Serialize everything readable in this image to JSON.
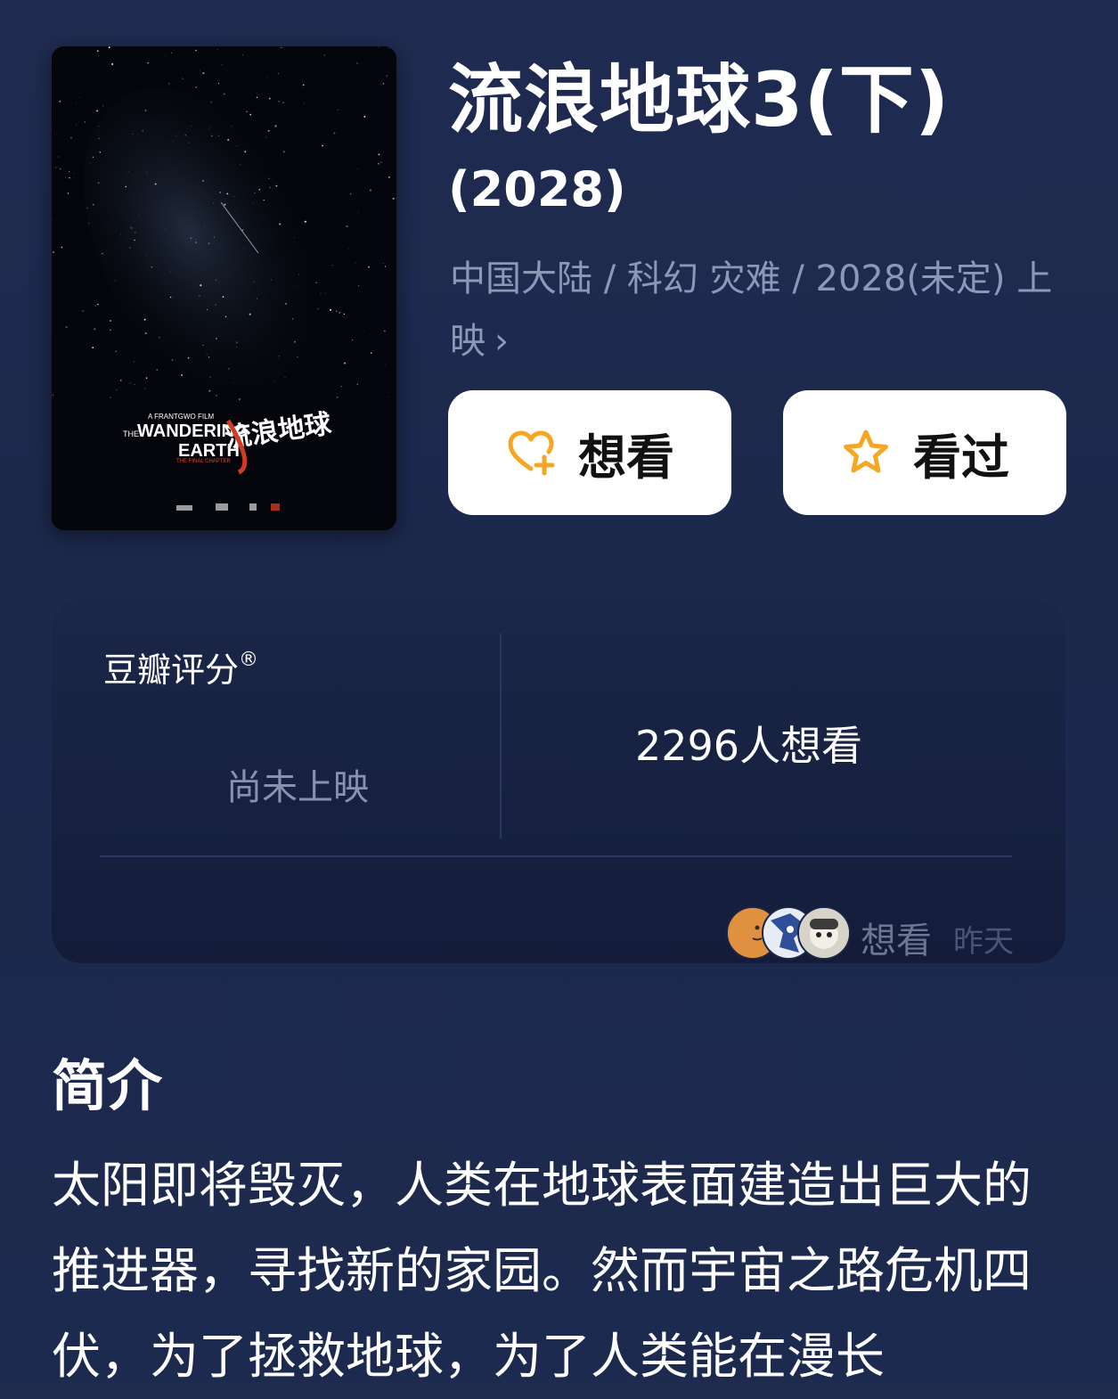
{
  "movie": {
    "title": "流浪地球3(下)",
    "year": "(2028)",
    "meta": "中国大陆 / 科幻 灾难 / 2028(未定) 上映",
    "meta_chevron": "›"
  },
  "poster": {
    "presenter": "A FRANTGWO FILM",
    "prefix": "THE",
    "title_en_line1": "WANDERING",
    "title_en_line2": "EARTH",
    "subtitle_en": "THE FINAL CHAPTER",
    "title_cn": "流浪地球"
  },
  "actions": {
    "want_label": "想看",
    "seen_label": "看过",
    "want_icon": "heart-plus-icon",
    "seen_icon": "star-icon",
    "accent_color": "#f5a623"
  },
  "rating": {
    "label": "豆瓣评分",
    "trademark": "®",
    "status": "尚未上映",
    "want_count": "2296人想看"
  },
  "activity": {
    "label": "想看",
    "time": "昨天"
  },
  "synopsis": {
    "title": "简介",
    "text": "太阳即将毁灭，人类在地球表面建造出巨大的推进器，寻找新的家园。然而宇宙之路危机四伏，为了拯救地球，为了人类能在漫长"
  }
}
